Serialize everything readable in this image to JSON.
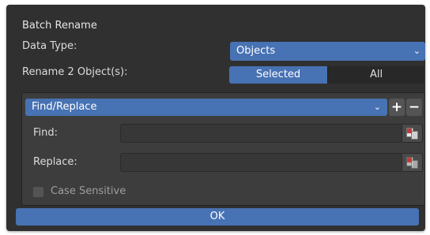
{
  "dialog": {
    "title": "Batch Rename",
    "data_type": {
      "label": "Data Type:",
      "value": "Objects"
    },
    "rename": {
      "label": "Rename 2 Object(s):",
      "options": [
        "Selected",
        "All"
      ],
      "selected": "Selected"
    },
    "operation": {
      "mode": "Find/Replace",
      "add_symbol": "+",
      "remove_symbol": "−",
      "find": {
        "label": "Find:",
        "value": ""
      },
      "replace": {
        "label": "Replace:",
        "value": ""
      },
      "case_sensitive": {
        "label": "Case Sensitive",
        "checked": false
      }
    },
    "ok_label": "OK"
  }
}
